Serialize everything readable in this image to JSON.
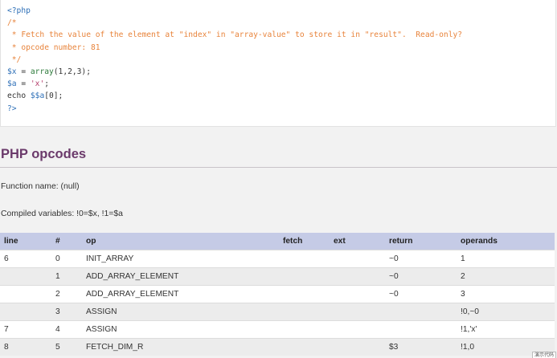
{
  "code": {
    "lines": [
      [
        {
          "t": "<?php",
          "c": "tag"
        }
      ],
      [
        {
          "t": "/*",
          "c": "com"
        }
      ],
      [
        {
          "t": " * Fetch the value of the element at \"index\" in \"array-value\" to store it in \"result\".  Read-only?",
          "c": "com"
        }
      ],
      [
        {
          "t": " * opcode number: 81",
          "c": "com"
        }
      ],
      [
        {
          "t": " */",
          "c": "com"
        }
      ],
      [
        {
          "t": "$x",
          "c": "var"
        },
        {
          "t": " = ",
          "c": "txt"
        },
        {
          "t": "array",
          "c": "fn"
        },
        {
          "t": "(1,2,3);",
          "c": "txt"
        }
      ],
      [
        {
          "t": "$a",
          "c": "var"
        },
        {
          "t": " = ",
          "c": "txt"
        },
        {
          "t": "'x'",
          "c": "str"
        },
        {
          "t": ";",
          "c": "txt"
        }
      ],
      [
        {
          "t": "echo ",
          "c": "txt"
        },
        {
          "t": "$$a",
          "c": "var"
        },
        {
          "t": "[0];",
          "c": "txt"
        }
      ],
      [
        {
          "t": "?>",
          "c": "tag"
        }
      ]
    ]
  },
  "section": {
    "title": "PHP opcodes",
    "function_name": "Function name: (null)",
    "compiled_vars": "Compiled variables: !0=$x, !1=$a"
  },
  "table": {
    "headers": [
      "line",
      "#",
      "op",
      "fetch",
      "ext",
      "return",
      "operands"
    ],
    "rows": [
      [
        "6",
        "0",
        "INIT_ARRAY",
        "",
        "",
        "~0",
        "1"
      ],
      [
        "",
        "1",
        "ADD_ARRAY_ELEMENT",
        "",
        "",
        "~0",
        "2"
      ],
      [
        "",
        "2",
        "ADD_ARRAY_ELEMENT",
        "",
        "",
        "~0",
        "3"
      ],
      [
        "",
        "3",
        "ASSIGN",
        "",
        "",
        "",
        "!0,~0"
      ],
      [
        "7",
        "4",
        "ASSIGN",
        "",
        "",
        "",
        "!1,'x'"
      ],
      [
        "8",
        "5",
        "FETCH_DIM_R",
        "",
        "",
        "$3",
        "!1,0"
      ]
    ]
  },
  "badge": "演示代码",
  "colors": {
    "title": "#6b3a6b",
    "header_bg": "#c5cbe6",
    "comment": "#e8843c",
    "keyword": "#2d6fb7"
  }
}
